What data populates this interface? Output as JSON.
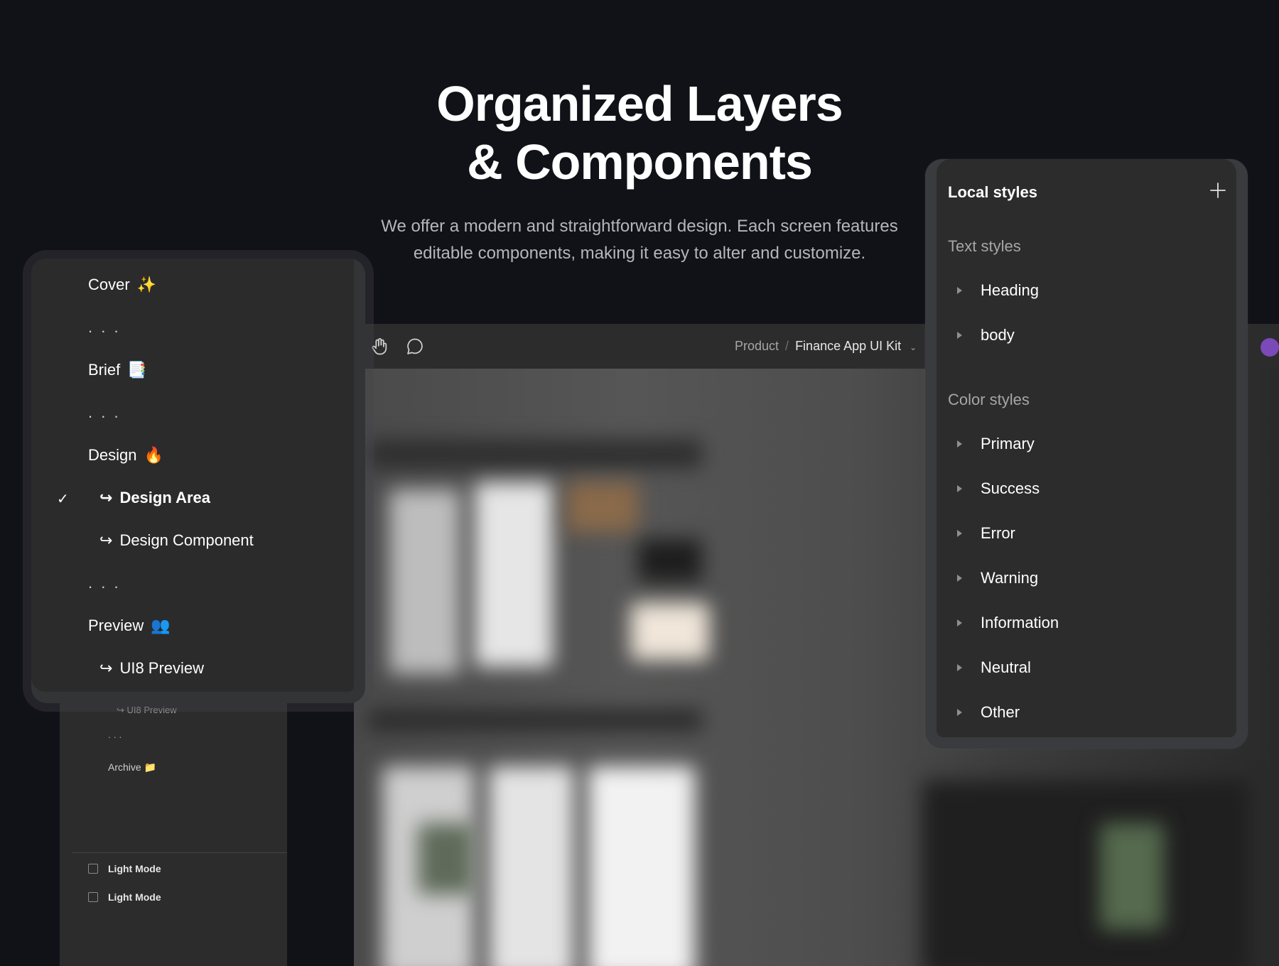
{
  "hero": {
    "title_line1": "Organized Layers",
    "title_line2": "& Components",
    "subtitle_line1": "We offer a modern and straightforward design. Each screen features",
    "subtitle_line2": "editable components, making it easy to alter and customize."
  },
  "toolbar": {
    "icons": [
      "hand-icon",
      "comment-icon"
    ],
    "breadcrumb_parent": "Product",
    "breadcrumb_separator": "/",
    "breadcrumb_current": "Finance App UI Kit",
    "breadcrumb_chevron": "⌄"
  },
  "pages": {
    "items": [
      {
        "label": "Cover",
        "emoji": "✨"
      },
      {
        "label": "Brief",
        "emoji": "📑"
      },
      {
        "label": "Design",
        "emoji": "🔥"
      },
      {
        "label": "Design Area"
      },
      {
        "label": "Design Component"
      },
      {
        "label": "Preview",
        "emoji": "👥"
      },
      {
        "label": "UI8 Preview"
      }
    ],
    "dots": ". . .",
    "check": "✓",
    "subpage_arrow": "↪"
  },
  "left_sidebar": {
    "ui8_preview": "UI8 Preview",
    "dots": ". . .",
    "archive": "Archive",
    "archive_emoji": "📁",
    "frames": [
      "Light Mode",
      "Light Mode"
    ]
  },
  "local_styles": {
    "title": "Local styles",
    "add_icon": "plus-icon",
    "text_styles_label": "Text styles",
    "text_styles": [
      "Heading",
      "body"
    ],
    "color_styles_label": "Color styles",
    "color_styles": [
      "Primary",
      "Success",
      "Error",
      "Warning",
      "Information",
      "Neutral",
      "Other"
    ]
  }
}
